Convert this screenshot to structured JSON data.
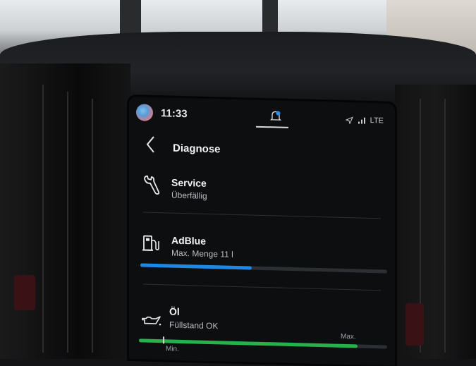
{
  "status_bar": {
    "time": "11:33",
    "network": "LTE",
    "icons": [
      "profile-avatar-icon",
      "notification-bell-icon",
      "location-arrow-icon",
      "signal-strength-icon"
    ]
  },
  "header": {
    "title": "Diagnose",
    "back_icon": "chevron-left-icon"
  },
  "items": [
    {
      "icon": "wrench-icon",
      "title": "Service",
      "subtitle": "Überfällig"
    },
    {
      "icon": "fuel-pump-icon",
      "title": "AdBlue",
      "subtitle": "Max. Menge 11 l",
      "level": 0.45
    },
    {
      "icon": "oil-can-icon",
      "title": "Öl",
      "subtitle": "Füllstand OK",
      "level": 0.88,
      "min_label": "Min.",
      "max_label": "Max."
    }
  ],
  "colors": {
    "accent_blue": "#1e88e5",
    "ok_green": "#26b24a",
    "notification_blue": "#2f8ff0"
  }
}
